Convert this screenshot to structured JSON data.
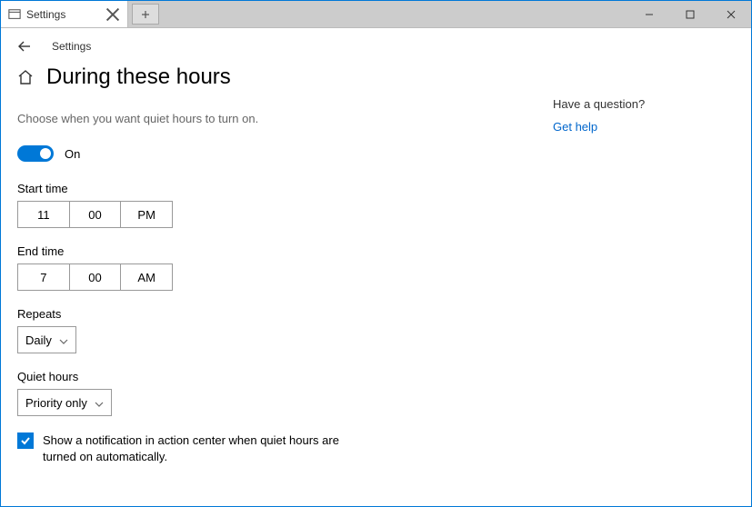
{
  "window": {
    "tab_title": "Settings"
  },
  "header": {
    "breadcrumb": "Settings"
  },
  "page": {
    "title": "During these hours",
    "description": "Choose when you want quiet hours to turn on."
  },
  "toggle": {
    "state_label": "On"
  },
  "start_time": {
    "label": "Start time",
    "hour": "11",
    "minute": "00",
    "period": "PM"
  },
  "end_time": {
    "label": "End time",
    "hour": "7",
    "minute": "00",
    "period": "AM"
  },
  "repeats": {
    "label": "Repeats",
    "value": "Daily"
  },
  "quiet_hours": {
    "label": "Quiet hours",
    "value": "Priority only"
  },
  "checkbox": {
    "label": "Show a notification in action center when quiet hours are turned on automatically."
  },
  "side": {
    "question": "Have a question?",
    "help_link": "Get help"
  }
}
